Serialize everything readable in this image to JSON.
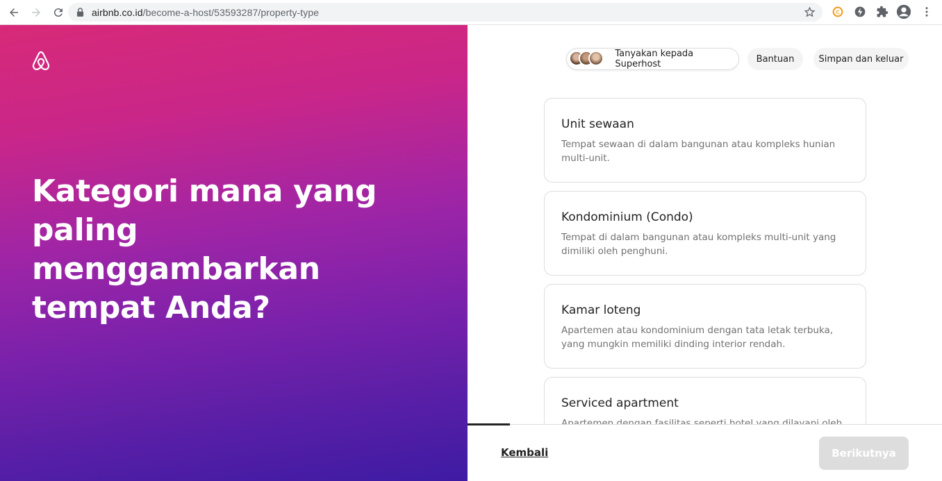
{
  "browser": {
    "url_domain": "airbnb.co.id",
    "url_path": "/become-a-host/53593287/property-type"
  },
  "hero": {
    "heading": "Kategori mana yang paling menggambarkan tempat Anda?"
  },
  "header": {
    "superhost_label": "Tanyakan kepada Superhost",
    "help_label": "Bantuan",
    "save_exit_label": "Simpan dan keluar"
  },
  "options": [
    {
      "title": "Unit sewaan",
      "description": "Tempat sewaan di dalam bangunan atau kompleks hunian multi-unit."
    },
    {
      "title": "Kondominium (Condo)",
      "description": "Tempat di dalam bangunan atau kompleks multi-unit yang dimiliki oleh penghuni."
    },
    {
      "title": "Kamar loteng",
      "description": "Apartemen atau kondominium dengan tata letak terbuka, yang mungkin memiliki dinding interior rendah."
    },
    {
      "title": "Serviced apartment",
      "description": "Apartemen dengan fasilitas seperti hotel yang dilayani oleh"
    }
  ],
  "footer": {
    "back_label": "Kembali",
    "next_label": "Berikutnya",
    "progress": 0.09
  },
  "colors": {
    "gradient_top": "#d72a78",
    "gradient_bottom": "#3e1ba3",
    "next_disabled": "#dddddd"
  }
}
